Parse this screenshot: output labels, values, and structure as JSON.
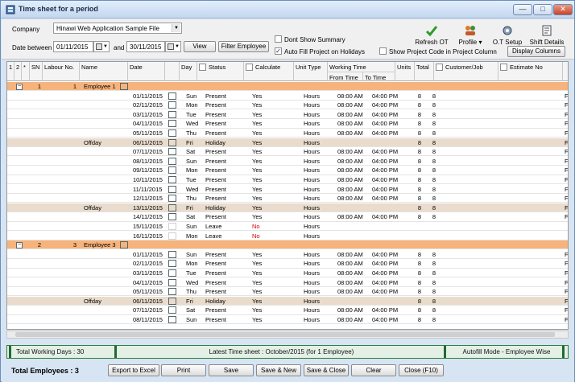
{
  "window": {
    "title": "Time sheet for a period",
    "min": "—",
    "max": "□",
    "close": "✕"
  },
  "filters": {
    "company_label": "Company",
    "company_value": "Hinawi Web Application Sample File",
    "date_between_label": "Date between",
    "date_from": "01/11/2015",
    "and_label": "and",
    "date_to": "30/11/2015",
    "view_label": "View",
    "filter_employee_label": "Filter Employee",
    "dont_show_summary": "Dont Show Summary",
    "auto_fill_project": "Auto Fill Project on Holidays",
    "show_project_code": "Show Project Code in Project Column",
    "display_columns": "Display Columns"
  },
  "toolbar": {
    "refresh_ot": "Refresh OT",
    "profile": "Profile",
    "ot_setup": "O.T Setup",
    "shift_details": "Shift Details"
  },
  "columns": {
    "c1": "1",
    "c2": "2",
    "star": "*",
    "sn": "SN",
    "labour_no": "Labour No.",
    "name": "Name",
    "date": "Date",
    "day": "Day",
    "status": "Status",
    "calculate": "Calculate",
    "unit_type": "Unit Type",
    "working_time": "Working Time",
    "from_time": "From Time",
    "to_time": "To Time",
    "units": "Units",
    "total": "Total",
    "customer_job": "Customer/Job",
    "estimate_no": "Estimate No"
  },
  "rows": [
    {
      "t": "grp",
      "sn": "1",
      "lab": "1",
      "name": "Employee 1"
    },
    {
      "t": "d",
      "date": "01/11/2015",
      "day": "Sun",
      "status": "Present",
      "calc": "Yes",
      "unit": "Hours",
      "from": "08:00 AM",
      "to": "04:00 PM",
      "units": "8",
      "total": "8",
      "est": "F"
    },
    {
      "t": "d",
      "date": "02/11/2015",
      "day": "Mon",
      "status": "Present",
      "calc": "Yes",
      "unit": "Hours",
      "from": "08:00 AM",
      "to": "04:00 PM",
      "units": "8",
      "total": "8",
      "est": "F"
    },
    {
      "t": "d",
      "date": "03/11/2015",
      "day": "Tue",
      "status": "Present",
      "calc": "Yes",
      "unit": "Hours",
      "from": "08:00 AM",
      "to": "04:00 PM",
      "units": "8",
      "total": "8",
      "est": "F"
    },
    {
      "t": "d",
      "date": "04/11/2015",
      "day": "Wed",
      "status": "Present",
      "calc": "Yes",
      "unit": "Hours",
      "from": "08:00 AM",
      "to": "04:00 PM",
      "units": "8",
      "total": "8",
      "est": "F"
    },
    {
      "t": "d",
      "date": "05/11/2015",
      "day": "Thu",
      "status": "Present",
      "calc": "Yes",
      "unit": "Hours",
      "from": "08:00 AM",
      "to": "04:00 PM",
      "units": "8",
      "total": "8",
      "est": "F"
    },
    {
      "t": "hol",
      "name": "Offday",
      "date": "06/11/2015",
      "day": "Fri",
      "status": "Holiday",
      "calc": "Yes",
      "unit": "Hours",
      "from": "",
      "to": "",
      "units": "8",
      "total": "8",
      "est": "F"
    },
    {
      "t": "d",
      "date": "07/11/2015",
      "day": "Sat",
      "status": "Present",
      "calc": "Yes",
      "unit": "Hours",
      "from": "08:00 AM",
      "to": "04:00 PM",
      "units": "8",
      "total": "8",
      "est": "F"
    },
    {
      "t": "d",
      "date": "08/11/2015",
      "day": "Sun",
      "status": "Present",
      "calc": "Yes",
      "unit": "Hours",
      "from": "08:00 AM",
      "to": "04:00 PM",
      "units": "8",
      "total": "8",
      "est": "F"
    },
    {
      "t": "d",
      "date": "09/11/2015",
      "day": "Mon",
      "status": "Present",
      "calc": "Yes",
      "unit": "Hours",
      "from": "08:00 AM",
      "to": "04:00 PM",
      "units": "8",
      "total": "8",
      "est": "F"
    },
    {
      "t": "d",
      "date": "10/11/2015",
      "day": "Tue",
      "status": "Present",
      "calc": "Yes",
      "unit": "Hours",
      "from": "08:00 AM",
      "to": "04:00 PM",
      "units": "8",
      "total": "8",
      "est": "F"
    },
    {
      "t": "d",
      "date": "11/11/2015",
      "day": "Wed",
      "status": "Present",
      "calc": "Yes",
      "unit": "Hours",
      "from": "08:00 AM",
      "to": "04:00 PM",
      "units": "8",
      "total": "8",
      "est": "F"
    },
    {
      "t": "d",
      "date": "12/11/2015",
      "day": "Thu",
      "status": "Present",
      "calc": "Yes",
      "unit": "Hours",
      "from": "08:00 AM",
      "to": "04:00 PM",
      "units": "8",
      "total": "8",
      "est": "F"
    },
    {
      "t": "hol",
      "name": "Offday",
      "date": "13/11/2015",
      "day": "Fri",
      "status": "Holiday",
      "calc": "Yes",
      "unit": "Hours",
      "from": "",
      "to": "",
      "units": "8",
      "total": "8",
      "est": "F"
    },
    {
      "t": "d",
      "date": "14/11/2015",
      "day": "Sat",
      "status": "Present",
      "calc": "Yes",
      "unit": "Hours",
      "from": "08:00 AM",
      "to": "04:00 PM",
      "units": "8",
      "total": "8",
      "est": "F"
    },
    {
      "t": "d",
      "date": "15/11/2015",
      "day": "Sun",
      "status": "Leave",
      "calc": "No",
      "unit": "Hours",
      "from": "",
      "to": "",
      "units": "",
      "total": "",
      "est": "",
      "cal_off": true
    },
    {
      "t": "d",
      "date": "16/11/2015",
      "day": "Mon",
      "status": "Leave",
      "calc": "No",
      "unit": "Hours",
      "from": "",
      "to": "",
      "units": "",
      "total": "",
      "est": "",
      "cal_off": true
    },
    {
      "t": "grp",
      "sn": "2",
      "lab": "3",
      "name": "Employee 3"
    },
    {
      "t": "d",
      "date": "01/11/2015",
      "day": "Sun",
      "status": "Present",
      "calc": "Yes",
      "unit": "Hours",
      "from": "08:00 AM",
      "to": "04:00 PM",
      "units": "8",
      "total": "8",
      "est": "F"
    },
    {
      "t": "d",
      "date": "02/11/2015",
      "day": "Mon",
      "status": "Present",
      "calc": "Yes",
      "unit": "Hours",
      "from": "08:00 AM",
      "to": "04:00 PM",
      "units": "8",
      "total": "8",
      "est": "F"
    },
    {
      "t": "d",
      "date": "03/11/2015",
      "day": "Tue",
      "status": "Present",
      "calc": "Yes",
      "unit": "Hours",
      "from": "08:00 AM",
      "to": "04:00 PM",
      "units": "8",
      "total": "8",
      "est": "F"
    },
    {
      "t": "d",
      "date": "04/11/2015",
      "day": "Wed",
      "status": "Present",
      "calc": "Yes",
      "unit": "Hours",
      "from": "08:00 AM",
      "to": "04:00 PM",
      "units": "8",
      "total": "8",
      "est": "F"
    },
    {
      "t": "d",
      "date": "05/11/2015",
      "day": "Thu",
      "status": "Present",
      "calc": "Yes",
      "unit": "Hours",
      "from": "08:00 AM",
      "to": "04:00 PM",
      "units": "8",
      "total": "8",
      "est": "F"
    },
    {
      "t": "hol",
      "name": "Offday",
      "date": "06/11/2015",
      "day": "Fri",
      "status": "Holiday",
      "calc": "Yes",
      "unit": "Hours",
      "from": "",
      "to": "",
      "units": "8",
      "total": "8",
      "est": "F"
    },
    {
      "t": "d",
      "date": "07/11/2015",
      "day": "Sat",
      "status": "Present",
      "calc": "Yes",
      "unit": "Hours",
      "from": "08:00 AM",
      "to": "04:00 PM",
      "units": "8",
      "total": "8",
      "est": "F"
    },
    {
      "t": "d",
      "date": "08/11/2015",
      "day": "Sun",
      "status": "Present",
      "calc": "Yes",
      "unit": "Hours",
      "from": "08:00 AM",
      "to": "04:00 PM",
      "units": "8",
      "total": "8",
      "est": "F"
    }
  ],
  "status_bar": {
    "total_working_days": "Total Working Days : 30",
    "latest_time_sheet": "Latest Time sheet : October/2015 (for 1 Employee)",
    "autofill_mode": "Autofill Mode - Employee Wise"
  },
  "footer": {
    "total_employees": "Total Employees : 3",
    "export_excel": "Export to Excel",
    "print": "Print",
    "save": "Save",
    "save_new": "Save & New",
    "save_close": "Save & Close",
    "clear": "Clear",
    "close_f10": "Close (F10)"
  },
  "colors": {
    "group_row": "#f7b37c",
    "holiday_row": "#e9dccd",
    "leave_no": "#d40000",
    "status_border": "#2e7d3a"
  }
}
